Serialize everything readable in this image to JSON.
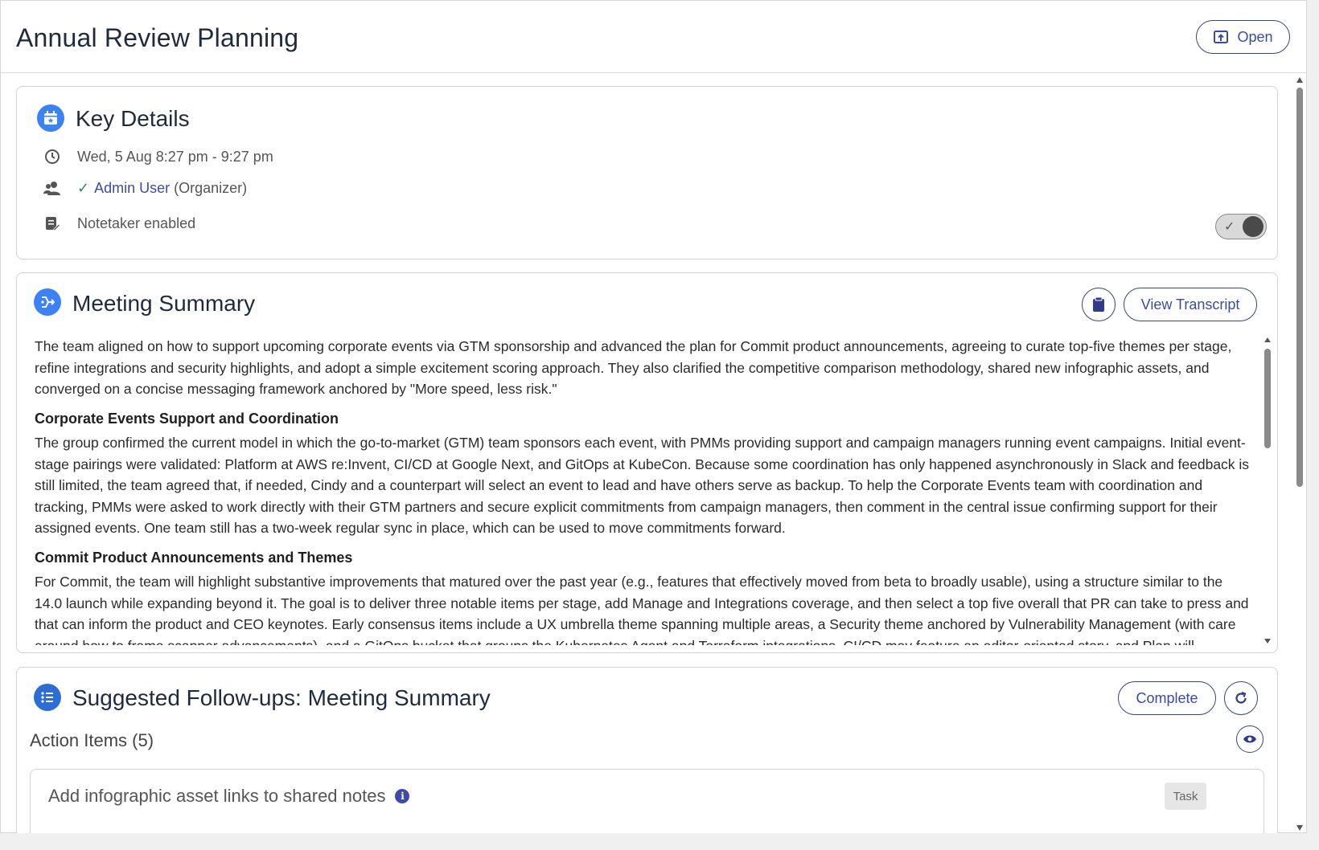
{
  "page": {
    "title": "Annual Review Planning",
    "open_label": "Open"
  },
  "key_details": {
    "title": "Key Details",
    "datetime": "Wed, 5 Aug 8:27 pm - 9:27 pm",
    "attendee_name": "Admin User",
    "attendee_role": "(Organizer)",
    "notetaker_label": "Notetaker enabled",
    "notetaker_enabled": true
  },
  "summary": {
    "title": "Meeting Summary",
    "view_transcript_label": "View Transcript",
    "intro": "The team aligned on how to support upcoming corporate events via GTM sponsorship and advanced the plan for Commit product announcements, agreeing to curate top-five themes per stage, refine integrations and security highlights, and adopt a simple excitement scoring approach. They also clarified the competitive comparison methodology, shared new infographic assets, and converged on a concise messaging framework anchored by \"More speed, less risk.\"",
    "sections": [
      {
        "heading": "Corporate Events Support and Coordination",
        "body": "The group confirmed the current model in which the go-to-market (GTM) team sponsors each event, with PMMs providing support and campaign managers running event campaigns. Initial event-stage pairings were validated: Platform at AWS re:Invent, CI/CD at Google Next, and GitOps at KubeCon. Because some coordination has only happened asynchronously in Slack and feedback is still limited, the team agreed that, if needed, Cindy and a counterpart will select an event to lead and have others serve as backup. To help the Corporate Events team with coordination and tracking, PMMs were asked to work directly with their GTM partners and secure explicit commitments from campaign managers, then comment in the central issue confirming support for their assigned events. One team still has a two-week regular sync in place, which can be used to move commitments forward."
      },
      {
        "heading": "Commit Product Announcements and Themes",
        "body": "For Commit, the team will highlight substantive improvements that matured over the past year (e.g., features that effectively moved from beta to broadly usable), using a structure similar to the 14.0 launch while expanding beyond it. The goal is to deliver three notable items per stage, add Manage and Integrations coverage, and then select a top five overall that PR can take to press and that can inform the product and CEO keynotes. Early consensus items include a UX umbrella theme spanning multiple areas, a Security theme anchored by Vulnerability Management (with care around how to frame scanner advancements), and a GitOps bucket that groups the Kubernetes Agent and Terraform integrations. CI/CD may feature an editor-oriented story, and Plan will"
      }
    ]
  },
  "followups": {
    "title": "Suggested Follow-ups: Meeting Summary",
    "complete_label": "Complete",
    "action_items_heading": "Action Items (5)",
    "items": [
      {
        "text": "Add infographic asset links to shared notes",
        "type": "Task"
      }
    ]
  },
  "icons": {
    "calendar": "calendar-star-icon",
    "clock": "clock-icon",
    "people": "people-icon",
    "notes": "notes-edit-icon",
    "summary": "summary-flow-icon",
    "clipboard": "clipboard-icon",
    "list": "list-icon",
    "refresh": "refresh-icon",
    "eye": "eye-icon",
    "info": "info-icon"
  },
  "colors": {
    "accent": "#3d4aa8",
    "icon_blue": "#3b82f6",
    "check": "#2e8b57",
    "toggle_knob": "#4a4a4a"
  }
}
